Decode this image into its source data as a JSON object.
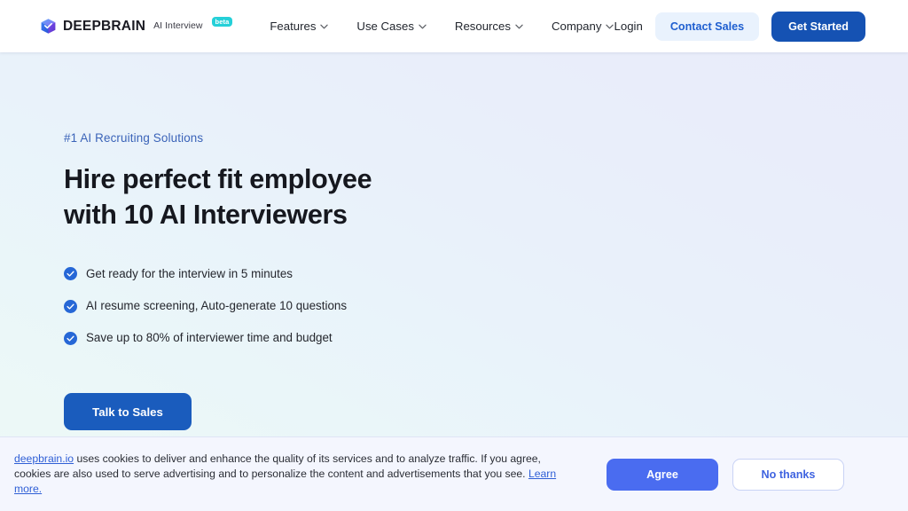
{
  "navbar": {
    "logo_icon": "deepbrain-cube-logo-icon",
    "brand_name": "DEEPBRAIN",
    "brand_sub": "AI Interview",
    "beta_label": "beta",
    "links": [
      {
        "label": "Features",
        "icon": "chevron-down-icon"
      },
      {
        "label": "Use Cases",
        "icon": "chevron-down-icon"
      },
      {
        "label": "Resources",
        "icon": "chevron-down-icon"
      },
      {
        "label": "Company",
        "icon": "chevron-down-icon"
      }
    ],
    "login_label": "Login",
    "contact_sales_label": "Contact Sales",
    "get_started_label": "Get Started"
  },
  "hero": {
    "eyebrow": "#1 AI Recruiting Solutions",
    "headline_line1": "Hire perfect fit employee",
    "headline_line2": "with 10 AI Interviewers",
    "bullets": [
      {
        "icon": "check-circle-icon",
        "text": "Get ready for the interview in 5 minutes"
      },
      {
        "icon": "check-circle-icon",
        "text": "AI resume screening, Auto-generate 10 questions"
      },
      {
        "icon": "check-circle-icon",
        "text": "Save up to 80% of interviewer time and budget"
      }
    ],
    "cta_label": "Talk to Sales"
  },
  "cookie_banner": {
    "domain_link": "deepbrain.io",
    "body_part1": " uses cookies to deliver and enhance the quality of its services and to analyze traffic. If you agree, cookies are also used to serve advertising and to personalize the content and advertisements that you see. ",
    "learn_more_label": "Learn more.",
    "agree_label": "Agree",
    "decline_label": "No thanks"
  },
  "colors": {
    "primary_blue": "#1552b3",
    "accent_blue": "#4a6cf0",
    "link_blue": "#2f5fd6",
    "eyebrow_blue": "#3a63b8",
    "beta_cyan": "#25d0d8",
    "contact_bg": "#e9f2fd",
    "banner_bg": "#f4f6fe"
  }
}
